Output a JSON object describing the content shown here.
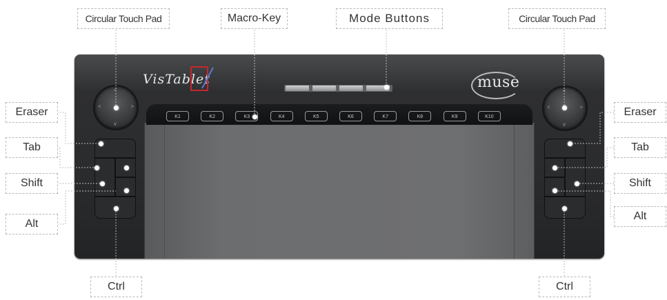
{
  "labels": {
    "touch_pad_left": "Circular Touch Pad",
    "macro_key": "Macro-Key",
    "mode_buttons": "Mode Buttons",
    "touch_pad_right": "Circular Touch Pad",
    "eraser_left": "Eraser",
    "tab_left": "Tab",
    "shift_left": "Shift",
    "alt_left": "Alt",
    "ctrl_left": "Ctrl",
    "eraser_right": "Eraser",
    "tab_right": "Tab",
    "shift_right": "Shift",
    "alt_right": "Alt",
    "ctrl_right": "Ctrl"
  },
  "device": {
    "brand_left": "VisTablet",
    "brand_right": "muse",
    "macro_keys": [
      "K1",
      "K2",
      "K3",
      "K4",
      "K5",
      "K6",
      "K7",
      "K8",
      "K9",
      "K10"
    ]
  },
  "colors": {
    "tablet_body": "#2a2b2d",
    "drawing_surface": "#6c6d6f",
    "logo_red": "#c6272c",
    "callout_border": "#b8b8b8"
  }
}
